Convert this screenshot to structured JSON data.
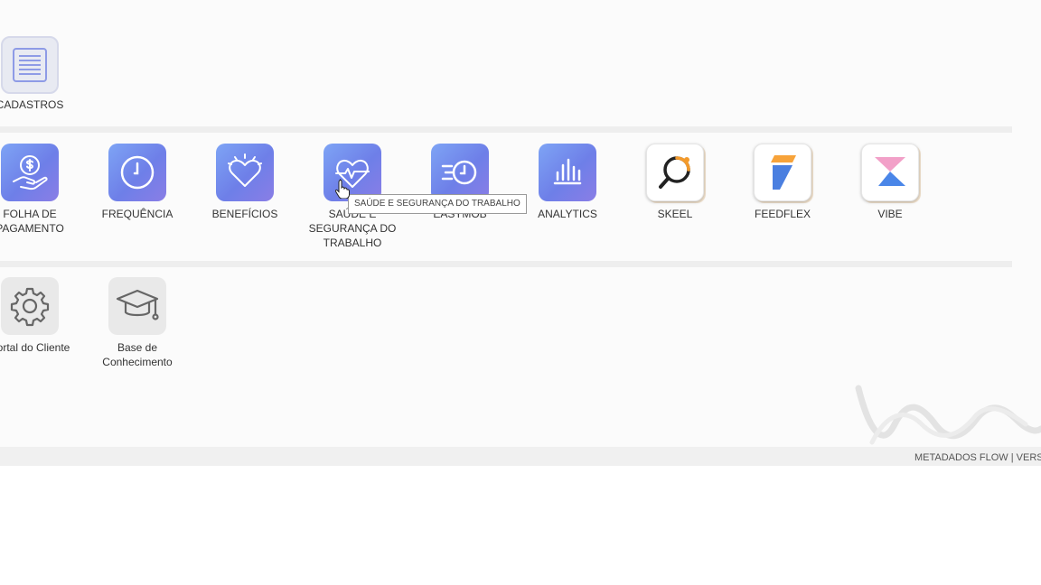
{
  "sections": {
    "top": {
      "items": [
        {
          "label": "CADASTROS",
          "icon": "document-list-icon"
        }
      ]
    },
    "apps": {
      "items": [
        {
          "label": "FOLHA DE PAGAMENTO",
          "icon": "hand-coin-icon"
        },
        {
          "label": "FREQUÊNCIA",
          "icon": "clock-icon"
        },
        {
          "label": "BENEFÍCIOS",
          "icon": "heart-icon"
        },
        {
          "label": "SAÚDE E SEGURANÇA DO TRABALHO",
          "icon": "heart-pulse-icon"
        },
        {
          "label": "EASYMOB",
          "icon": "fast-clock-icon"
        },
        {
          "label": "ANALYTICS",
          "icon": "bar-chart-icon"
        },
        {
          "label": "SKEEL",
          "icon": "skeel-logo-icon"
        },
        {
          "label": "FEEDFLEX",
          "icon": "feedflex-logo-icon"
        },
        {
          "label": "VIBE",
          "icon": "vibe-logo-icon"
        }
      ]
    },
    "support": {
      "items": [
        {
          "label": "Portal do Cliente",
          "icon": "gear-icon"
        },
        {
          "label": "Base de Conhecimento",
          "icon": "graduation-cap-icon"
        }
      ]
    }
  },
  "tooltip": {
    "text": "SAÚDE E SEGURANÇA DO TRABALHO"
  },
  "footer": {
    "text": "METADADOS FLOW | VERSÃO"
  },
  "colors": {
    "icon_gradient_start": "#7ea4f5",
    "icon_gradient_end": "#8a7ee6",
    "skeel_accent": "#f39a2b",
    "feedflex_orange": "#f7a33a",
    "feedflex_blue": "#4a7fe0",
    "vibe_pink": "#f2a0c8",
    "vibe_blue": "#4a86e8"
  }
}
